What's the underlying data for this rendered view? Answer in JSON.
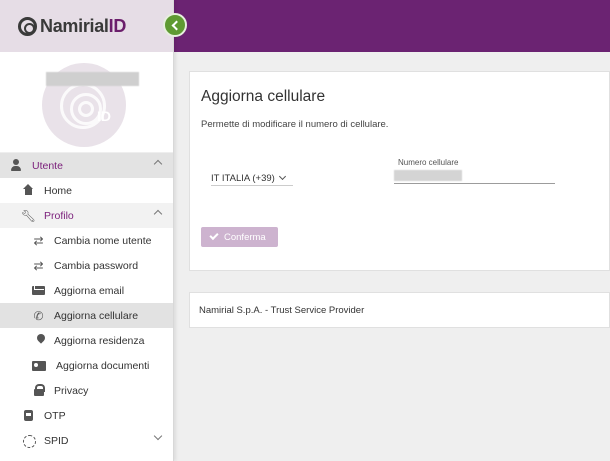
{
  "brand": {
    "name_main": "Namirial",
    "name_id": "ID"
  },
  "colors": {
    "topbar": "#6b2372",
    "accent": "#7a1e7a",
    "collapse_button": "#5f9a32",
    "confirm_disabled": "#cdb3cf"
  },
  "sidebar": {
    "items": [
      {
        "label": "Utente",
        "icon": "user-icon",
        "level": 0,
        "state": "section-open"
      },
      {
        "label": "Home",
        "icon": "home-icon",
        "level": 1
      },
      {
        "label": "Profilo",
        "icon": "wrench-icon",
        "level": 1,
        "state": "subsection-open"
      },
      {
        "label": "Cambia nome utente",
        "icon": "swap-icon",
        "level": 2
      },
      {
        "label": "Cambia password",
        "icon": "swap-icon",
        "level": 2
      },
      {
        "label": "Aggiorna email",
        "icon": "envelope-icon",
        "level": 2
      },
      {
        "label": "Aggiorna cellulare",
        "icon": "phone-icon",
        "level": 2,
        "state": "active"
      },
      {
        "label": "Aggiorna residenza",
        "icon": "map-pin-icon",
        "level": 2
      },
      {
        "label": "Aggiorna documenti",
        "icon": "id-card-icon",
        "level": 2
      },
      {
        "label": "Privacy",
        "icon": "lock-icon",
        "level": 2
      },
      {
        "label": "OTP",
        "icon": "otp-token-icon",
        "level": 0
      },
      {
        "label": "SPID",
        "icon": "fingerprint-icon",
        "level": 0,
        "state": "collapsed"
      }
    ]
  },
  "main": {
    "title": "Aggiorna cellulare",
    "description": "Permette di modificare il numero di cellulare.",
    "country_select": {
      "value": "IT ITALIA (+39)"
    },
    "phone_field": {
      "label": "Numero cellulare"
    },
    "confirm_button": {
      "label": "Conferma",
      "enabled": false
    }
  },
  "footer": {
    "text": "Namirial S.p.A. - Trust Service Provider"
  }
}
